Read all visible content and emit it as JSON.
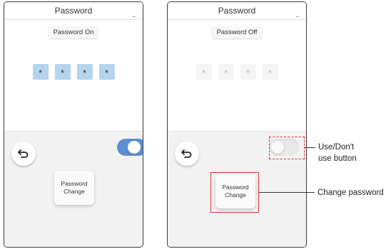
{
  "left_screen": {
    "title": "Password",
    "status_label": "Password On",
    "pin_digits": [
      "*",
      "*",
      "*",
      "*"
    ],
    "toggle_state": "on",
    "change_button": {
      "line1": "Password",
      "line2": "Change"
    }
  },
  "right_screen": {
    "title": "Password",
    "status_label": "Password Off",
    "pin_digits": [
      "*",
      "*",
      "*",
      "*"
    ],
    "toggle_state": "off",
    "change_button": {
      "line1": "Password",
      "line2": "Change"
    }
  },
  "annotations": {
    "toggle_callout_line1": "Use/Don't",
    "toggle_callout_line2": "use button",
    "change_callout": "Change password"
  },
  "colors": {
    "toggle_on": "#5d8fd0",
    "pin_on": "#b4d3ee",
    "annotation_red": "#e0312f"
  },
  "icons": {
    "back": "back-arrow-icon"
  }
}
